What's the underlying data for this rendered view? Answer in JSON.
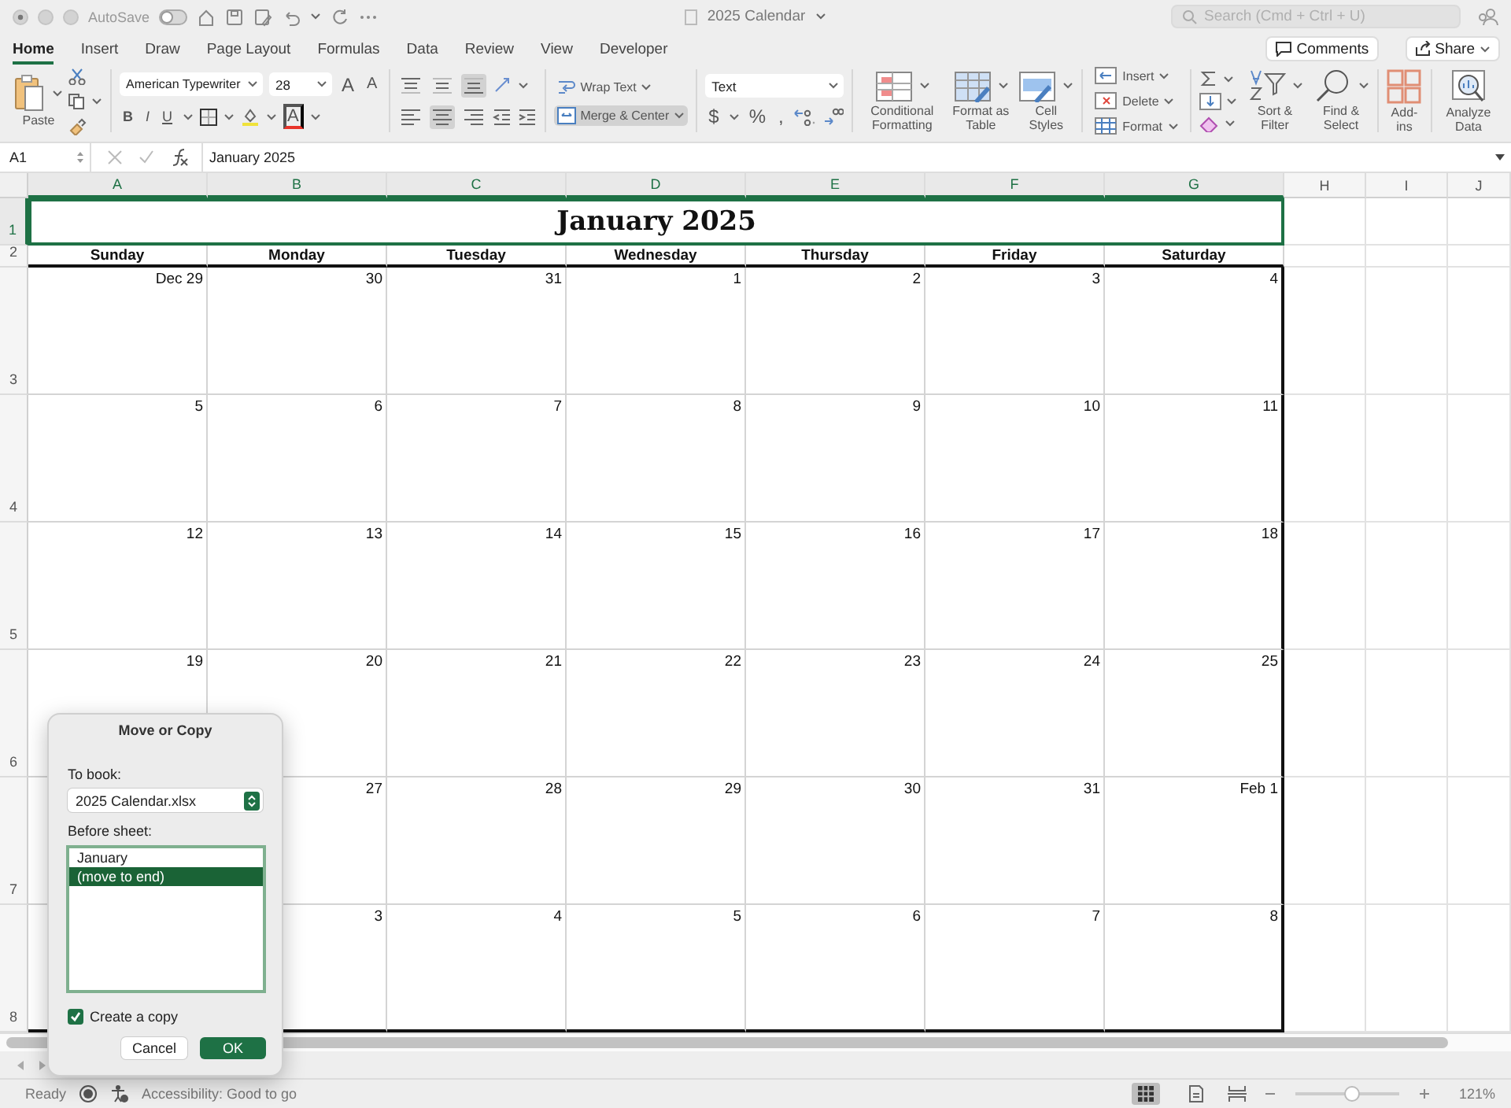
{
  "title_bar": {
    "autosave_label": "AutoSave",
    "autosave_on": false,
    "document_title": "2025 Calendar",
    "search_placeholder": "Search (Cmd + Ctrl + U)"
  },
  "ribbon_tabs": [
    {
      "label": "Home",
      "selected": true
    },
    {
      "label": "Insert",
      "selected": false
    },
    {
      "label": "Draw",
      "selected": false
    },
    {
      "label": "Page Layout",
      "selected": false
    },
    {
      "label": "Formulas",
      "selected": false
    },
    {
      "label": "Data",
      "selected": false
    },
    {
      "label": "Review",
      "selected": false
    },
    {
      "label": "View",
      "selected": false
    },
    {
      "label": "Developer",
      "selected": false
    }
  ],
  "comments_button": "Comments",
  "share_button": "Share",
  "ribbon": {
    "paste_label": "Paste",
    "font_name": "American Typewriter",
    "font_size": "28",
    "grow_font": "A",
    "shrink_font": "A",
    "font_style_buttons": [
      "B",
      "I",
      "U"
    ],
    "font_color": "A",
    "alignment": [
      {
        "kind": "top",
        "selected": false
      },
      {
        "kind": "middle",
        "selected": false
      },
      {
        "kind": "bottom",
        "selected": true
      },
      {
        "kind": "left",
        "selected": false
      },
      {
        "kind": "center",
        "selected": true
      },
      {
        "kind": "right",
        "selected": false
      }
    ],
    "wrap_text": {
      "label": "Wrap Text",
      "selected": false
    },
    "merge_center": {
      "label": "Merge & Center",
      "selected": true
    },
    "number_format": "Text",
    "currency": "$",
    "percent": "%",
    "comma": ",",
    "styles": [
      {
        "kind": "conditional",
        "label": "Conditional Formatting"
      },
      {
        "kind": "table",
        "label": "Format as Table"
      },
      {
        "kind": "cell",
        "label": "Cell Styles"
      }
    ],
    "cells": [
      {
        "kind": "insert",
        "label": "Insert"
      },
      {
        "kind": "delete",
        "label": "Delete"
      },
      {
        "kind": "format",
        "label": "Format"
      }
    ],
    "editing": [
      {
        "kind": "sort",
        "label": "Sort & Filter"
      },
      {
        "kind": "find",
        "label": "Find & Select"
      }
    ],
    "add_ins": "Add-ins",
    "analyze_data": "Analyze Data"
  },
  "formula_bar": {
    "cell_reference": "A1",
    "content": "January 2025"
  },
  "sheet": {
    "columns": [
      {
        "label": "A",
        "selected": true
      },
      {
        "label": "B",
        "selected": true
      },
      {
        "label": "C",
        "selected": true
      },
      {
        "label": "D",
        "selected": true
      },
      {
        "label": "E",
        "selected": true
      },
      {
        "label": "F",
        "selected": true
      },
      {
        "label": "G",
        "selected": true
      },
      {
        "label": "H",
        "selected": false
      },
      {
        "label": "I",
        "selected": false
      },
      {
        "label": "J",
        "selected": false
      }
    ],
    "rows": [
      {
        "label": "1",
        "selected": true
      },
      {
        "label": "2",
        "selected": false
      },
      {
        "label": "3",
        "selected": false
      },
      {
        "label": "4",
        "selected": false
      },
      {
        "label": "5",
        "selected": false
      },
      {
        "label": "6",
        "selected": false
      },
      {
        "label": "7",
        "selected": false
      },
      {
        "label": "8",
        "selected": false
      }
    ],
    "calendar": {
      "title": "January 2025",
      "weekdays": [
        "Sunday",
        "Monday",
        "Tuesday",
        "Wednesday",
        "Thursday",
        "Friday",
        "Saturday"
      ],
      "weeks": [
        [
          "Dec 29",
          "30",
          "31",
          "1",
          "2",
          "3",
          "4"
        ],
        [
          "5",
          "6",
          "7",
          "8",
          "9",
          "10",
          "11"
        ],
        [
          "12",
          "13",
          "14",
          "15",
          "16",
          "17",
          "18"
        ],
        [
          "19",
          "20",
          "21",
          "22",
          "23",
          "24",
          "25"
        ],
        [
          "27",
          "28",
          "29",
          "30",
          "31",
          "Feb 1"
        ],
        [
          "3",
          "4",
          "5",
          "6",
          "7",
          "8"
        ]
      ]
    }
  },
  "dialog": {
    "title": "Move or Copy",
    "to_book_label": "To book:",
    "book": "2025 Calendar.xlsx",
    "before_sheet_label": "Before sheet:",
    "sheets": [
      {
        "label": "January",
        "selected": false
      },
      {
        "label": "(move to end)",
        "selected": true
      }
    ],
    "create_copy": {
      "label": "Create a copy",
      "checked": true
    },
    "cancel_button": "Cancel",
    "ok_button": "OK"
  },
  "status_bar": {
    "status": "Ready",
    "accessibility": "Accessibility: Good to go",
    "views": [
      {
        "kind": "normal",
        "selected": true
      },
      {
        "kind": "page_layout",
        "selected": false
      },
      {
        "kind": "page_break",
        "selected": false
      }
    ],
    "zoom_slider": {
      "level": 0.54
    },
    "zoom_percent": "121%"
  }
}
